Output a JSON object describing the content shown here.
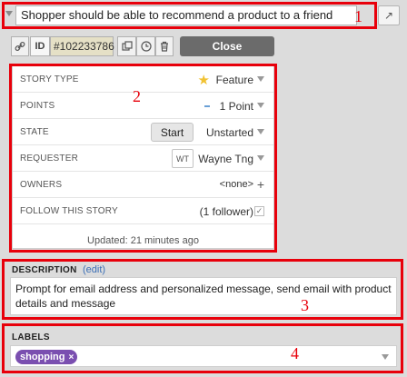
{
  "story": {
    "title": "Shopper should be able to recommend a product to a friend",
    "expand_icon": "↗"
  },
  "toolbar": {
    "link_icon": "link-icon",
    "id_label": "ID",
    "id_value": "#102233786",
    "close_label": "Close"
  },
  "details": {
    "story_type": {
      "label": "STORY TYPE",
      "value": "Feature"
    },
    "points": {
      "label": "POINTS",
      "value": "1 Point"
    },
    "state": {
      "label": "STATE",
      "action": "Start",
      "value": "Unstarted"
    },
    "requester": {
      "label": "REQUESTER",
      "initials": "WT",
      "value": "Wayne Tng"
    },
    "owners": {
      "label": "OWNERS",
      "value": "<none>"
    },
    "follow": {
      "label": "FOLLOW THIS STORY",
      "value": "(1 follower)"
    },
    "updated": "Updated: 21 minutes ago"
  },
  "description": {
    "title": "DESCRIPTION",
    "edit_label": "(edit)",
    "text": "Prompt for email address and personalized message, send email with product details and message"
  },
  "labels": {
    "title": "LABELS",
    "items": [
      {
        "name": "shopping",
        "remove": "×"
      }
    ]
  },
  "annotations": [
    "1",
    "2",
    "3",
    "4"
  ],
  "colors": {
    "annotation": "#e8000b",
    "label_chip": "#7a4fb0",
    "close_button": "#6b6b6b",
    "link": "#3b6fb6"
  }
}
